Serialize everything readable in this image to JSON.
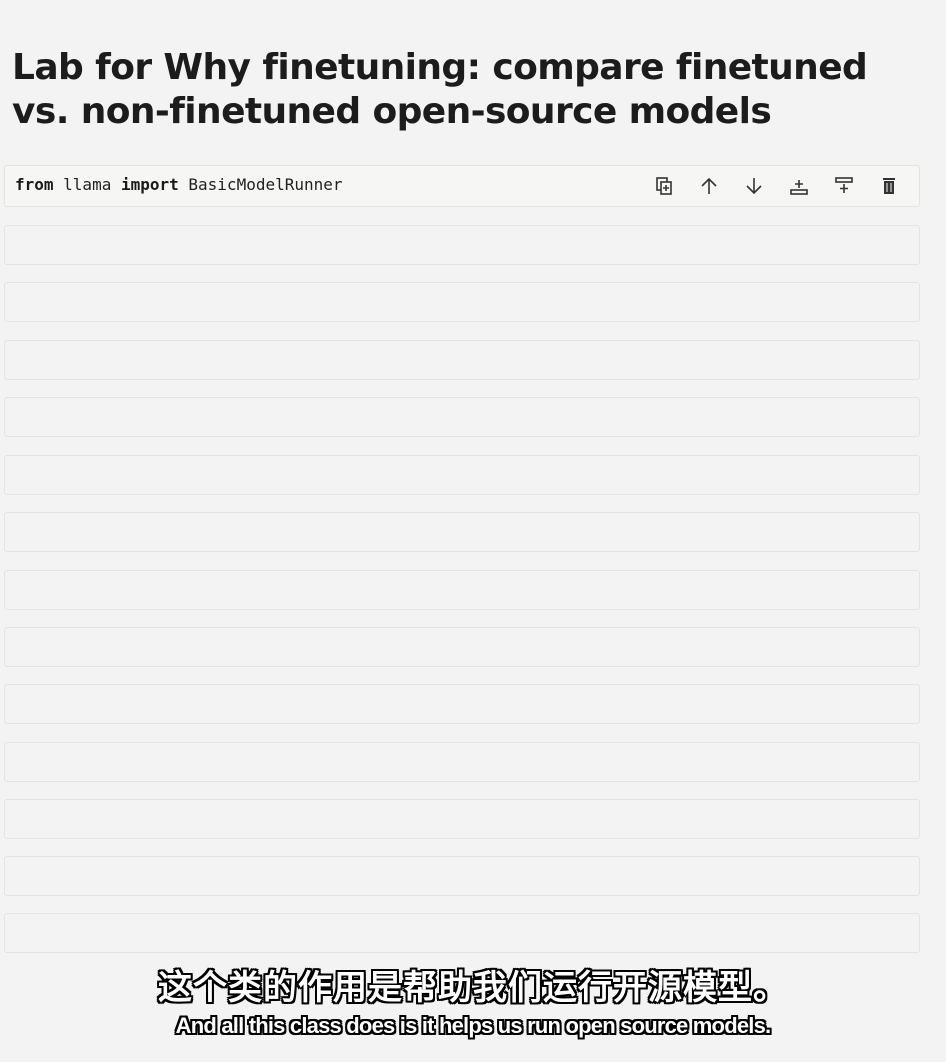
{
  "notebook": {
    "title": "Lab for Why finetuning: compare finetuned vs. non-finetuned open-source models"
  },
  "active_cell": {
    "code_tokens": [
      "from",
      " llama ",
      "import",
      " BasicModelRunner"
    ]
  },
  "toolbar": {
    "buttons": [
      {
        "icon": "duplicate-icon"
      },
      {
        "icon": "move-up-icon"
      },
      {
        "icon": "move-down-icon"
      },
      {
        "icon": "insert-above-icon"
      },
      {
        "icon": "insert-below-icon"
      },
      {
        "icon": "delete-icon"
      }
    ]
  },
  "subtitles": {
    "chinese": "这个类的作用是帮助我们运行开源模型。",
    "english": "And all this class does is it helps us run open source models."
  },
  "colors": {
    "background": "#f3f3f3",
    "cell_border": "#e4e4dc",
    "text": "#1c1c1c",
    "subtitle_text": "#ffffff",
    "subtitle_outline": "#000000"
  }
}
